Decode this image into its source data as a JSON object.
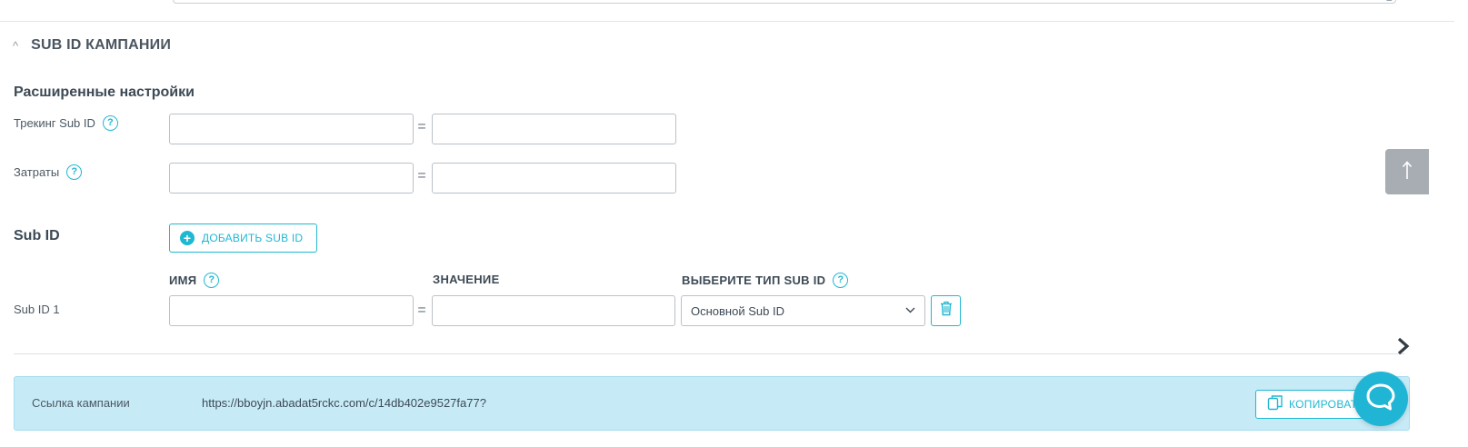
{
  "section": {
    "title": "SUB ID КАМПАНИИ"
  },
  "advanced": {
    "title": "Расширенные настройки",
    "rows": [
      {
        "label": "Трекинг Sub ID",
        "left_value": "",
        "right_value": ""
      },
      {
        "label": "Затраты",
        "left_value": "",
        "right_value": ""
      }
    ]
  },
  "subid": {
    "title": "Sub ID",
    "add_label": "ДОБАВИТЬ SUB ID",
    "columns": {
      "name": "ИМЯ",
      "value": "ЗНАЧЕНИЕ",
      "type": "ВЫБЕРИТЕ ТИП SUB ID"
    },
    "rows": [
      {
        "label": "Sub ID 1",
        "name": "",
        "value": "",
        "type": "Основной Sub ID"
      }
    ]
  },
  "link": {
    "label": "Ссылка кампании",
    "url": "https://bboyjn.abadat5rckc.com/c/14db402e9527fa77?",
    "copy_label": "КОПИРОВАТЬ"
  },
  "symbols": {
    "help": "?",
    "equals": "=",
    "plus": "+"
  },
  "icons": {
    "collapse": "chevron-up-icon",
    "help": "question-circle-icon",
    "add": "plus-circle-icon",
    "select": "chevron-down-icon",
    "delete": "trash-icon",
    "next": "chevron-right-icon",
    "scroll": "arrow-up-icon",
    "copy": "copy-icon",
    "chat": "chat-bubble-icon"
  },
  "colors": {
    "accent": "#1fb8d2",
    "link_bar": "#c6ebf7",
    "scroll_btn": "#a7adb2",
    "chat": "#21b5d5",
    "text": "#3d4a55"
  }
}
